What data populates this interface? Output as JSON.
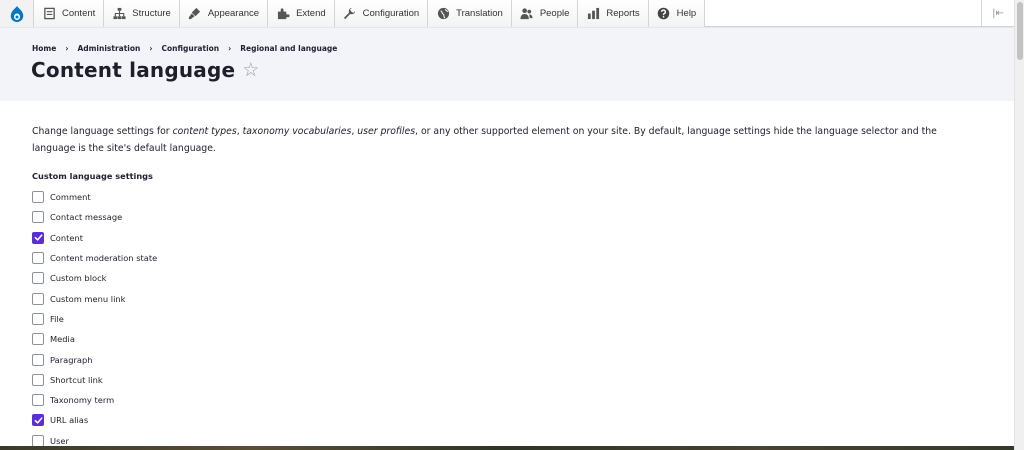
{
  "toolbar": {
    "logo": "drupal-drop-logo",
    "items": [
      {
        "label": "Content",
        "icon": "content-icon"
      },
      {
        "label": "Structure",
        "icon": "structure-icon"
      },
      {
        "label": "Appearance",
        "icon": "appearance-icon"
      },
      {
        "label": "Extend",
        "icon": "extend-icon"
      },
      {
        "label": "Configuration",
        "icon": "configuration-icon"
      },
      {
        "label": "Translation",
        "icon": "translation-icon"
      },
      {
        "label": "People",
        "icon": "people-icon"
      },
      {
        "label": "Reports",
        "icon": "reports-icon"
      },
      {
        "label": "Help",
        "icon": "help-icon"
      }
    ],
    "collapse_glyph": "|⇤"
  },
  "breadcrumb": {
    "items": [
      "Home",
      "Administration",
      "Configuration",
      "Regional and language"
    ],
    "separator": "›"
  },
  "page": {
    "title": "Content language",
    "star": "☆"
  },
  "description": {
    "before": "Change language settings for ",
    "em1": "content types",
    "sep1": ", ",
    "em2": "taxonomy vocabularies",
    "sep2": ", ",
    "em3": "user profiles",
    "after": ", or any other supported element on your site. By default, language settings hide the language selector and the language is the site's default language."
  },
  "settings": {
    "label": "Custom language settings",
    "items": [
      {
        "label": "Comment",
        "checked": false
      },
      {
        "label": "Contact message",
        "checked": false
      },
      {
        "label": "Content",
        "checked": true
      },
      {
        "label": "Content moderation state",
        "checked": false
      },
      {
        "label": "Custom block",
        "checked": false
      },
      {
        "label": "Custom menu link",
        "checked": false
      },
      {
        "label": "File",
        "checked": false
      },
      {
        "label": "Media",
        "checked": false
      },
      {
        "label": "Paragraph",
        "checked": false
      },
      {
        "label": "Shortcut link",
        "checked": false
      },
      {
        "label": "Taxonomy term",
        "checked": false
      },
      {
        "label": "URL alias",
        "checked": true
      },
      {
        "label": "User",
        "checked": false
      }
    ]
  },
  "colors": {
    "accent": "#5b2fd5",
    "header_bg": "#f3f4f9",
    "logo_blue": "#0678be"
  }
}
